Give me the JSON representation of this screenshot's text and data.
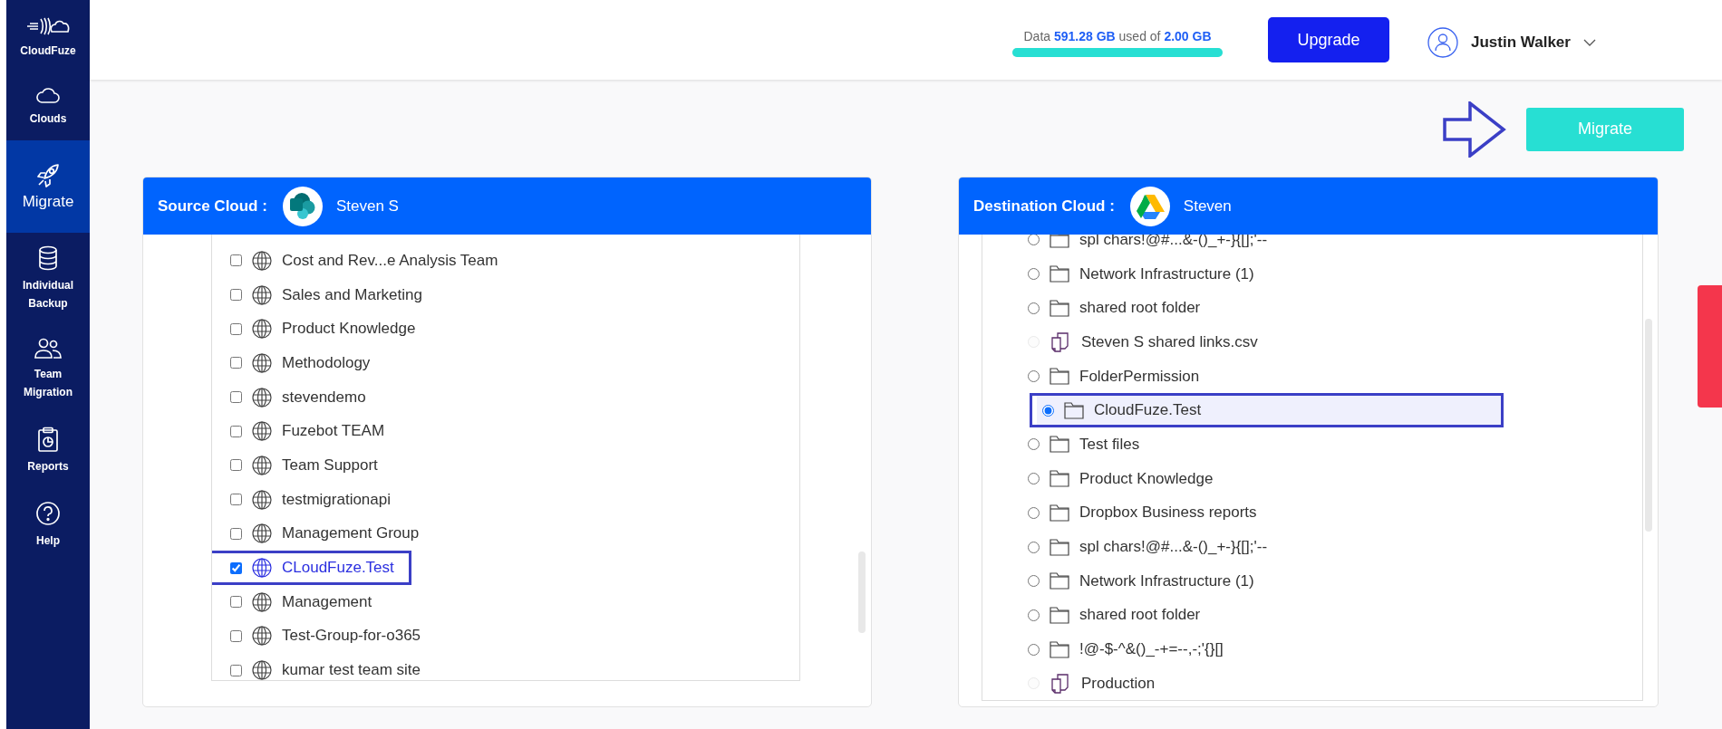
{
  "sidebar": {
    "brand": "CloudFuze",
    "items": [
      {
        "label": "Clouds",
        "kind": "cloud",
        "selected": false
      },
      {
        "label": "Migrate",
        "kind": "rocket",
        "selected": true
      },
      {
        "label": "Individual Backup",
        "kind": "database",
        "selected": false
      },
      {
        "label": "Team Migration",
        "kind": "people",
        "selected": false
      },
      {
        "label": "Reports",
        "kind": "clipboard",
        "selected": false
      },
      {
        "label": "Help",
        "kind": "help",
        "selected": false
      }
    ]
  },
  "header": {
    "usage": {
      "text": "Data **591.28 GB** used of **2.00 GB**",
      "level": 1
    },
    "upgrade": "Upgrade",
    "user": "Justin Walker"
  },
  "migrate_button": "Migrate",
  "source": {
    "title": "Source Cloud :",
    "account": "Steven S",
    "kind": "sharepoint",
    "items": [
      {
        "label": "Cost and Rev...e Analysis Team",
        "checked": false
      },
      {
        "label": "Sales and Marketing",
        "checked": false
      },
      {
        "label": "Product Knowledge",
        "checked": false
      },
      {
        "label": "Methodology",
        "checked": false
      },
      {
        "label": "stevendemo",
        "checked": false
      },
      {
        "label": "Fuzebot TEAM",
        "checked": false
      },
      {
        "label": "Team Support",
        "checked": false
      },
      {
        "label": "testmigrationapi",
        "checked": false
      },
      {
        "label": "Management Group",
        "checked": false
      },
      {
        "label": "CLoudFuze.Test",
        "checked": true
      },
      {
        "label": "Management",
        "checked": false
      },
      {
        "label": "Test-Group-for-o365",
        "checked": false
      },
      {
        "label": "kumar test team site",
        "checked": false
      }
    ]
  },
  "destination": {
    "title": "Destination Cloud :",
    "account": "Steven",
    "kind": "drive",
    "items": [
      {
        "label": "spl chars!@#...&-()_+-}{[];'--",
        "kind": "folder",
        "selected": false
      },
      {
        "label": "Network Infrastructure (1)",
        "kind": "folder",
        "selected": false
      },
      {
        "label": "shared root folder",
        "kind": "folder",
        "selected": false
      },
      {
        "label": "Steven S shared links.csv",
        "kind": "file",
        "selected": false
      },
      {
        "label": "FolderPermission",
        "kind": "folder",
        "selected": false
      },
      {
        "label": "CloudFuze.Test",
        "kind": "folder",
        "selected": true
      },
      {
        "label": "Test files",
        "kind": "folder",
        "selected": false
      },
      {
        "label": "Product Knowledge",
        "kind": "folder",
        "selected": false
      },
      {
        "label": "Dropbox Business reports",
        "kind": "folder",
        "selected": false
      },
      {
        "label": "spl chars!@#...&-()_+-}{[];'--",
        "kind": "folder",
        "selected": false
      },
      {
        "label": "Network Infrastructure (1)",
        "kind": "folder",
        "selected": false
      },
      {
        "label": "shared root folder",
        "kind": "folder",
        "selected": false
      },
      {
        "label": "!@-$-^&()_-+=--,-;'{}[]",
        "kind": "folder",
        "selected": false
      },
      {
        "label": "Production",
        "kind": "file",
        "selected": false
      }
    ]
  }
}
